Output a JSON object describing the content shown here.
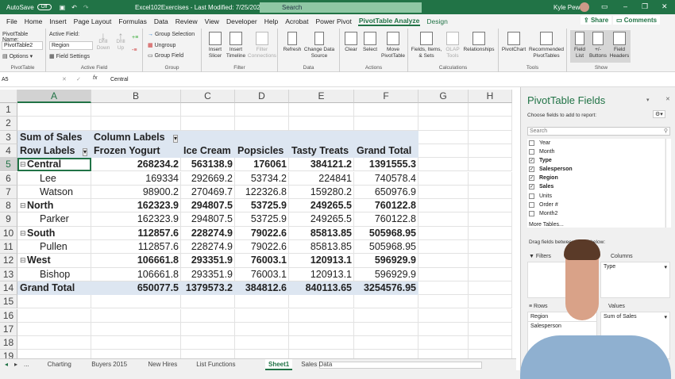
{
  "titlebar": {
    "autosave": "AutoSave",
    "autosave_state": "Off",
    "doc_title": "Excel102Exercises - Last Modified: 7/25/2020",
    "search_placeholder": "Search",
    "user": "Kyle Pew"
  },
  "menu": [
    "File",
    "Home",
    "Insert",
    "Page Layout",
    "Formulas",
    "Data",
    "Review",
    "View",
    "Developer",
    "Help",
    "Acrobat",
    "Power Pivot",
    "PivotTable Analyze",
    "Design"
  ],
  "menu_active": "PivotTable Analyze",
  "share": "Share",
  "comments": "Comments",
  "ribbon": {
    "pivottable_name_label": "PivotTable Name:",
    "pivottable_name": "PivotTable2",
    "options": "Options",
    "group_pivottable": "PivotTable",
    "active_field_label": "Active Field:",
    "active_field": "Region",
    "field_settings": "Field Settings",
    "drill_down": "Drill Down",
    "drill_up": "Drill Up",
    "group_active_field": "Active Field",
    "group_selection": "Group Selection",
    "ungroup": "Ungroup",
    "group_field": "Group Field",
    "group_group": "Group",
    "insert_slicer": "Insert Slicer",
    "insert_timeline": "Insert Timeline",
    "filter_connections": "Filter Connections",
    "group_filter": "Filter",
    "refresh": "Refresh",
    "change_data_source": "Change Data Source",
    "group_data": "Data",
    "clear": "Clear",
    "select": "Select",
    "move_pivottable": "Move PivotTable",
    "group_actions": "Actions",
    "fields_items_sets": "Fields, Items, & Sets",
    "olap_tools": "OLAP Tools",
    "relationships": "Relationships",
    "group_calculations": "Calculations",
    "pivotchart": "PivotChart",
    "recommended_pivottables": "Recommended PivotTables",
    "group_tools": "Tools",
    "field_list": "Field List",
    "buttons": "+/- Buttons",
    "field_headers": "Field Headers",
    "group_show": "Show"
  },
  "formula_bar": {
    "name_box": "A5",
    "formula": "Central"
  },
  "columns": [
    "A",
    "B",
    "C",
    "D",
    "E",
    "F",
    "G",
    "H"
  ],
  "rows": [
    "1",
    "2",
    "3",
    "4",
    "5",
    "6",
    "7",
    "8",
    "9",
    "10",
    "11",
    "12",
    "13",
    "14",
    "15",
    "16",
    "17",
    "18",
    "19"
  ],
  "pivot": {
    "sum_label": "Sum of Sales",
    "column_labels": "Column Labels",
    "row_labels": "Row Labels",
    "headers": [
      "Frozen Yogurt",
      "Ice Cream",
      "Popsicles",
      "Tasty Treats",
      "Grand Total"
    ],
    "data": [
      {
        "label": "Central",
        "level": 0,
        "values": [
          "268234.2",
          "563138.9",
          "176061",
          "384121.2",
          "1391555.3"
        ]
      },
      {
        "label": "Lee",
        "level": 1,
        "values": [
          "169334",
          "292669.2",
          "53734.2",
          "224841",
          "740578.4"
        ]
      },
      {
        "label": "Watson",
        "level": 1,
        "values": [
          "98900.2",
          "270469.7",
          "122326.8",
          "159280.2",
          "650976.9"
        ]
      },
      {
        "label": "North",
        "level": 0,
        "values": [
          "162323.9",
          "294807.5",
          "53725.9",
          "249265.5",
          "760122.8"
        ]
      },
      {
        "label": "Parker",
        "level": 1,
        "values": [
          "162323.9",
          "294807.5",
          "53725.9",
          "249265.5",
          "760122.8"
        ]
      },
      {
        "label": "South",
        "level": 0,
        "values": [
          "112857.6",
          "228274.9",
          "79022.6",
          "85813.85",
          "505968.95"
        ]
      },
      {
        "label": "Pullen",
        "level": 1,
        "values": [
          "112857.6",
          "228274.9",
          "79022.6",
          "85813.85",
          "505968.95"
        ]
      },
      {
        "label": "West",
        "level": 0,
        "values": [
          "106661.8",
          "293351.9",
          "76003.1",
          "120913.1",
          "596929.9"
        ]
      },
      {
        "label": "Bishop",
        "level": 1,
        "values": [
          "106661.8",
          "293351.9",
          "76003.1",
          "120913.1",
          "596929.9"
        ]
      }
    ],
    "grand_total": {
      "label": "Grand Total",
      "values": [
        "650077.5",
        "1379573.2",
        "384812.6",
        "840113.65",
        "3254576.95"
      ]
    }
  },
  "sheet_tabs": [
    "...",
    "Charting",
    "Buyers 2015",
    "New Hires",
    "List Functions",
    "Sheet1",
    "Sales Data"
  ],
  "active_tab": "Sheet1",
  "panel": {
    "title": "PivotTable Fields",
    "choose": "Choose fields to add to report:",
    "search_placeholder": "Search",
    "fields": [
      {
        "name": "Year",
        "checked": false
      },
      {
        "name": "Month",
        "checked": false
      },
      {
        "name": "Type",
        "checked": true
      },
      {
        "name": "Salesperson",
        "checked": true
      },
      {
        "name": "Region",
        "checked": true
      },
      {
        "name": "Sales",
        "checked": true
      },
      {
        "name": "Units",
        "checked": false
      },
      {
        "name": "Order #",
        "checked": false
      },
      {
        "name": "Month2",
        "checked": false
      }
    ],
    "more_tables": "More Tables...",
    "drag": "Drag fields between areas below:",
    "filters": "Filters",
    "columns": "Columns",
    "columns_item": "Type",
    "rows": "Rows",
    "values": "Values",
    "rows_items": [
      "Region",
      "Salesperson"
    ],
    "values_items": [
      "Sum of Sales"
    ]
  },
  "colors": {
    "excel_green": "#217346",
    "pivot_header": "#dde6f1"
  }
}
